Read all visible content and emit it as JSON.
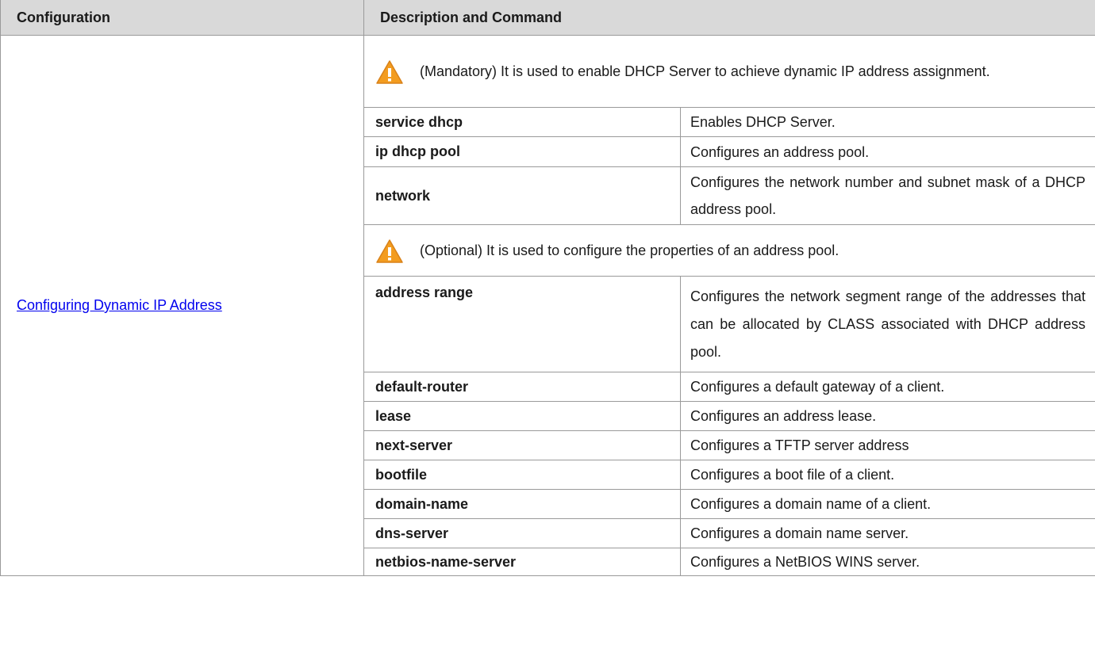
{
  "header": {
    "configuration": "Configuration",
    "description_and_command": "Description and Command"
  },
  "config_link": "Configuring Dynamic IP Address",
  "mandatory_note": "(Mandatory) It is used to enable DHCP Server to achieve dynamic IP address assignment.",
  "mandatory_rows": [
    {
      "command": "service dhcp",
      "description": "Enables DHCP Server."
    },
    {
      "command": "ip dhcp pool",
      "description": "Configures an address pool."
    },
    {
      "command": "network",
      "description": "Configures the network number and subnet mask of a DHCP address pool."
    }
  ],
  "optional_note": "(Optional) It is used to configure the properties of an address pool.",
  "optional_rows": [
    {
      "command": "address range",
      "description": "Configures the network segment range of the addresses that can be allocated by CLASS associated with DHCP address pool."
    },
    {
      "command": "default-router",
      "description": "Configures a default gateway of a client."
    },
    {
      "command": "lease",
      "description": "Configures an address lease."
    },
    {
      "command": "next-server",
      "description": "Configures a TFTP server address"
    },
    {
      "command": "bootfile",
      "description": "Configures a boot file of a client."
    },
    {
      "command": "domain-name",
      "description": "Configures a domain name of a client."
    },
    {
      "command": "dns-server",
      "description": "Configures a domain name server."
    },
    {
      "command": "netbios-name-server",
      "description": "Configures a NetBIOS WINS server."
    }
  ],
  "icons": {
    "warning": "warning-triangle-icon",
    "warning_color": "#f39c1f"
  }
}
